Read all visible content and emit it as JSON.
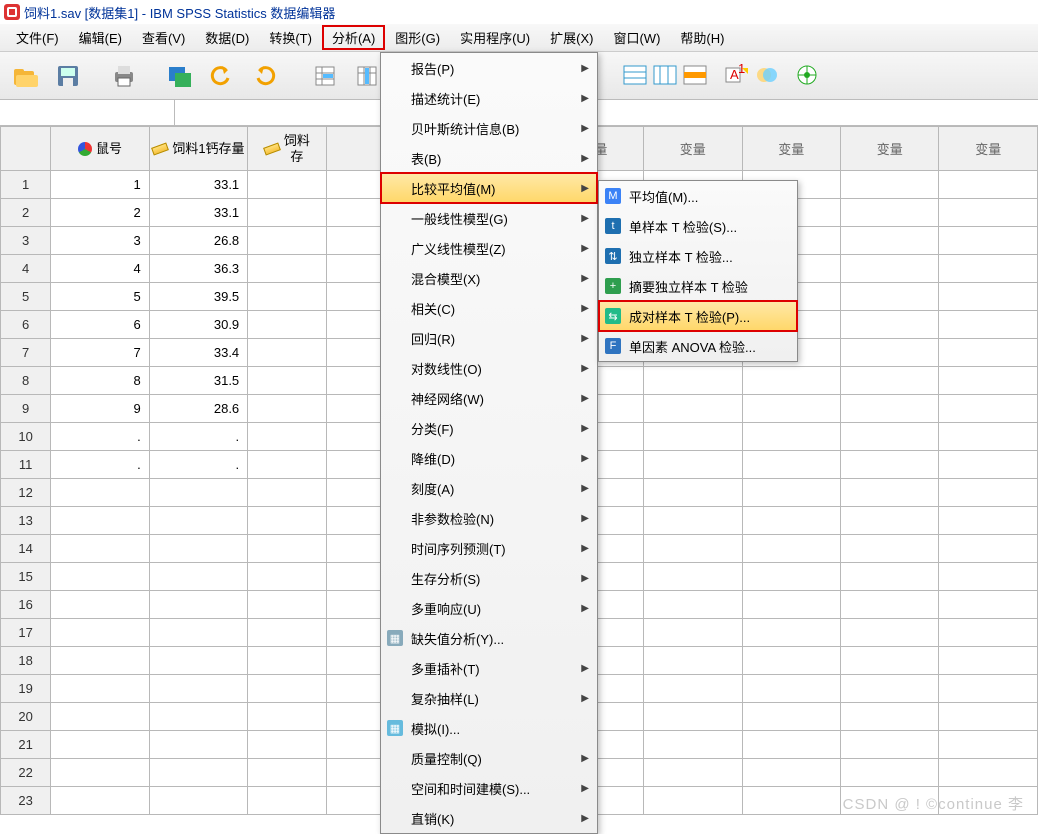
{
  "title": "饲料1.sav [数据集1] - IBM SPSS Statistics 数据编辑器",
  "menubar": {
    "file": "文件(F)",
    "edit": "编辑(E)",
    "view": "查看(V)",
    "data": "数据(D)",
    "transform": "转换(T)",
    "analyze": "分析(A)",
    "graphs": "图形(G)",
    "utilities": "实用程序(U)",
    "extensions": "扩展(X)",
    "window": "窗口(W)",
    "help": "帮助(H)"
  },
  "columns": {
    "c0": "鼠号",
    "c1": "饲料1钙存量",
    "c2": "饲料\n存",
    "placeholder": "变量"
  },
  "rows": [
    {
      "n": "1",
      "c0": "1",
      "c1": "33.1"
    },
    {
      "n": "2",
      "c0": "2",
      "c1": "33.1"
    },
    {
      "n": "3",
      "c0": "3",
      "c1": "26.8"
    },
    {
      "n": "4",
      "c0": "4",
      "c1": "36.3"
    },
    {
      "n": "5",
      "c0": "5",
      "c1": "39.5"
    },
    {
      "n": "6",
      "c0": "6",
      "c1": "30.9"
    },
    {
      "n": "7",
      "c0": "7",
      "c1": "33.4"
    },
    {
      "n": "8",
      "c0": "8",
      "c1": "31.5"
    },
    {
      "n": "9",
      "c0": "9",
      "c1": "28.6"
    },
    {
      "n": "10",
      "c0": ".",
      "c1": "."
    },
    {
      "n": "11",
      "c0": ".",
      "c1": "."
    },
    {
      "n": "12",
      "c0": "",
      "c1": ""
    },
    {
      "n": "13",
      "c0": "",
      "c1": ""
    },
    {
      "n": "14",
      "c0": "",
      "c1": ""
    },
    {
      "n": "15",
      "c0": "",
      "c1": ""
    },
    {
      "n": "16",
      "c0": "",
      "c1": ""
    },
    {
      "n": "17",
      "c0": "",
      "c1": ""
    },
    {
      "n": "18",
      "c0": "",
      "c1": ""
    },
    {
      "n": "19",
      "c0": "",
      "c1": ""
    },
    {
      "n": "20",
      "c0": "",
      "c1": ""
    },
    {
      "n": "21",
      "c0": "",
      "c1": ""
    },
    {
      "n": "22",
      "c0": "",
      "c1": ""
    },
    {
      "n": "23",
      "c0": "",
      "c1": ""
    }
  ],
  "analyzeMenu": [
    {
      "label": "报告(P)",
      "arrow": true
    },
    {
      "label": "描述统计(E)",
      "arrow": true
    },
    {
      "label": "贝叶斯统计信息(B)",
      "arrow": true
    },
    {
      "label": "表(B)",
      "arrow": true
    },
    {
      "label": "比较平均值(M)",
      "arrow": true,
      "hl": true,
      "boxed": true
    },
    {
      "label": "一般线性模型(G)",
      "arrow": true
    },
    {
      "label": "广义线性模型(Z)",
      "arrow": true
    },
    {
      "label": "混合模型(X)",
      "arrow": true
    },
    {
      "label": "相关(C)",
      "arrow": true
    },
    {
      "label": "回归(R)",
      "arrow": true
    },
    {
      "label": "对数线性(O)",
      "arrow": true
    },
    {
      "label": "神经网络(W)",
      "arrow": true
    },
    {
      "label": "分类(F)",
      "arrow": true
    },
    {
      "label": "降维(D)",
      "arrow": true
    },
    {
      "label": "刻度(A)",
      "arrow": true
    },
    {
      "label": "非参数检验(N)",
      "arrow": true
    },
    {
      "label": "时间序列预测(T)",
      "arrow": true
    },
    {
      "label": "生存分析(S)",
      "arrow": true
    },
    {
      "label": "多重响应(U)",
      "arrow": true
    },
    {
      "label": "缺失值分析(Y)...",
      "arrow": false,
      "icon": "#8ab"
    },
    {
      "label": "多重插补(T)",
      "arrow": true
    },
    {
      "label": "复杂抽样(L)",
      "arrow": true
    },
    {
      "label": "模拟(I)...",
      "arrow": false,
      "icon": "#6bd"
    },
    {
      "label": "质量控制(Q)",
      "arrow": true
    },
    {
      "label": "空间和时间建模(S)...",
      "arrow": true
    },
    {
      "label": "直销(K)",
      "arrow": true
    }
  ],
  "compareMenu": [
    {
      "label": "平均值(M)...",
      "icon": "#3b82f6",
      "t": "M"
    },
    {
      "label": "单样本 T 检验(S)...",
      "icon": "#1e6fb0",
      "t": "t"
    },
    {
      "label": "独立样本 T 检验...",
      "icon": "#1e6fb0",
      "t": "⇅"
    },
    {
      "label": "摘要独立样本 T 检验",
      "icon": "#2e9e4e",
      "t": "+"
    },
    {
      "label": "成对样本 T 检验(P)...",
      "icon": "#2b8",
      "t": "⇆",
      "hl": true,
      "boxed": true
    },
    {
      "label": "单因素 ANOVA 检验...",
      "icon": "#2f74c0",
      "t": "F"
    }
  ],
  "watermark": "CSDN @ ! ©continue 李"
}
